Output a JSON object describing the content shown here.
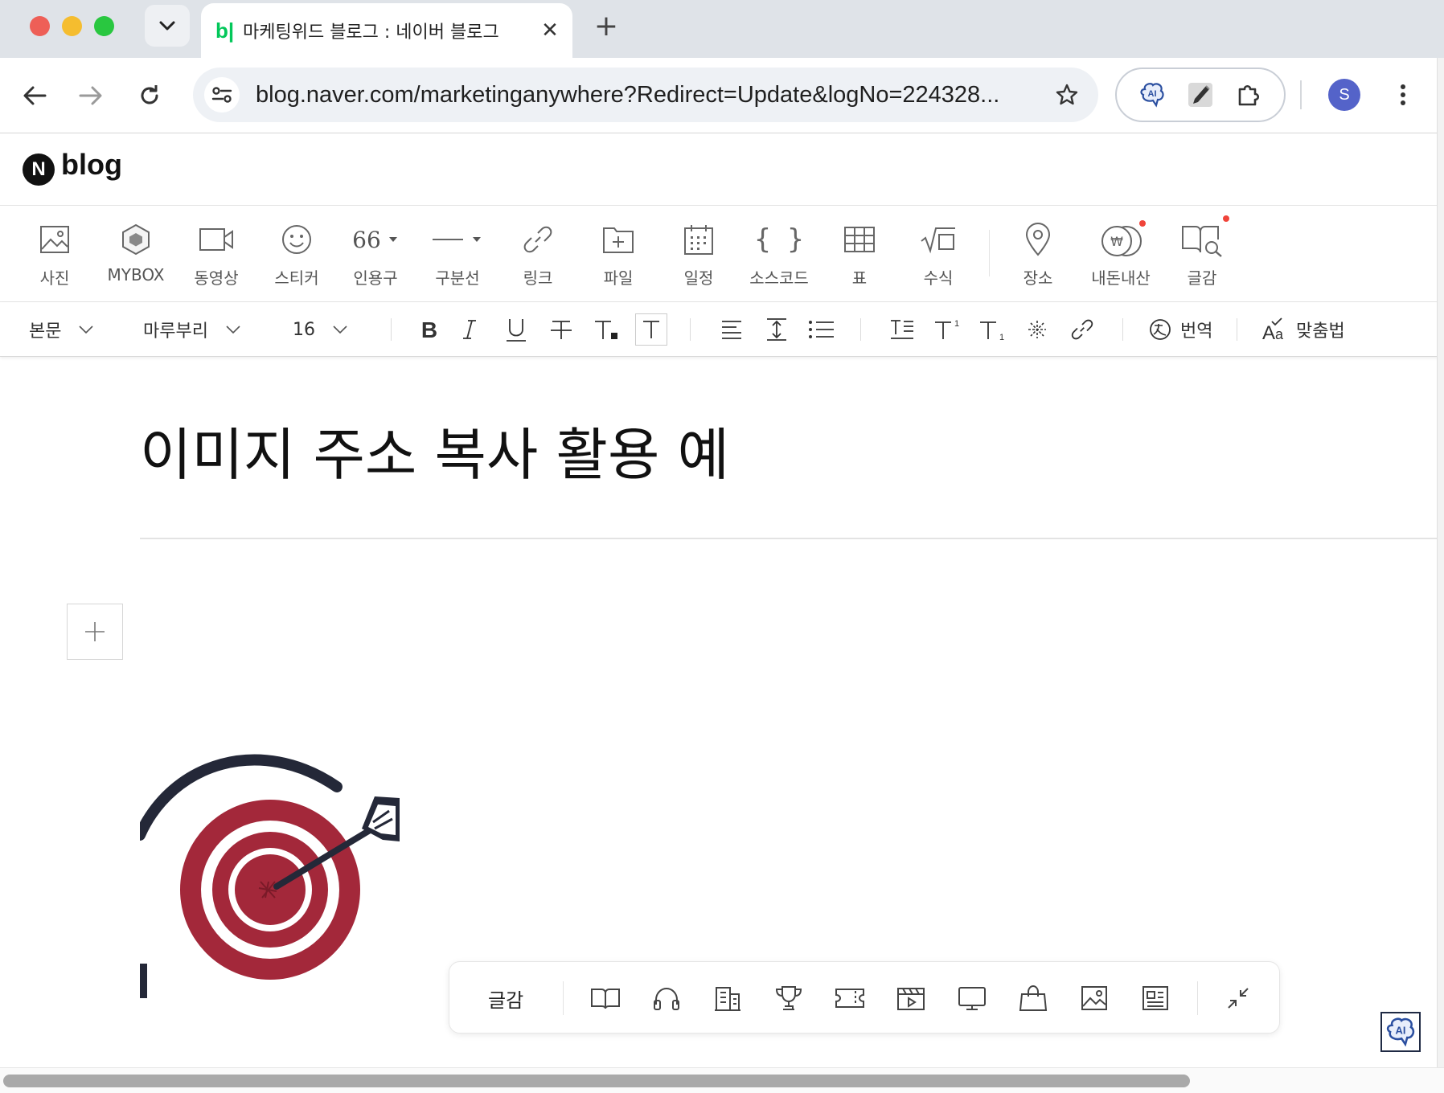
{
  "browser": {
    "tab": {
      "favicon_text": "b|",
      "title": "마케팅위드 블로그 : 네이버 블로그",
      "close_glyph": "✕"
    },
    "new_tab_glyph": "+",
    "url": "blog.naver.com/marketinganywhere?Redirect=Update&logNo=224328...",
    "avatar_initial": "S",
    "colors": {
      "tabstrip": "#dfe3e8",
      "omnibox": "#eef1f5",
      "avatar": "#5463c9"
    }
  },
  "blog": {
    "logo_letter": "N",
    "logo_text": "blog"
  },
  "insert_toolbar": {
    "items": [
      {
        "label": "사진",
        "icon": "photo-icon"
      },
      {
        "label": "MYBOX",
        "icon": "mybox-icon"
      },
      {
        "label": "동영상",
        "icon": "video-icon"
      },
      {
        "label": "스티커",
        "icon": "sticker-icon"
      },
      {
        "label": "인용구",
        "icon": "quote-icon",
        "glyph": "66"
      },
      {
        "label": "구분선",
        "icon": "divider-icon"
      },
      {
        "label": "링크",
        "icon": "link-icon"
      },
      {
        "label": "파일",
        "icon": "file-icon"
      },
      {
        "label": "일정",
        "icon": "calendar-icon"
      },
      {
        "label": "소스코드",
        "icon": "code-icon",
        "glyph": "{ }"
      },
      {
        "label": "표",
        "icon": "table-icon"
      },
      {
        "label": "수식",
        "icon": "formula-icon"
      },
      {
        "label": "장소",
        "icon": "place-icon"
      },
      {
        "label": "내돈내산",
        "icon": "own-money-icon",
        "badge": true
      },
      {
        "label": "글감",
        "icon": "material-icon",
        "badge": true
      }
    ]
  },
  "format_toolbar": {
    "paragraph_style": "본문",
    "font": "마루부리",
    "font_size": "16",
    "translate_label": "번역",
    "spellcheck_label": "맞춤법"
  },
  "document": {
    "title": "이미지 주소 복사 활용 예"
  },
  "material_bar": {
    "label": "글감",
    "icons": [
      "book-icon",
      "music-icon",
      "building-icon",
      "trophy-icon",
      "ticket-icon",
      "movie-icon",
      "tv-icon",
      "shopping-bag-icon",
      "image-icon",
      "news-icon"
    ]
  },
  "colors": {
    "accent_green": "#03c75a",
    "badge_red": "#f0443a",
    "target_red": "#a3283a",
    "target_navy": "#242838"
  }
}
